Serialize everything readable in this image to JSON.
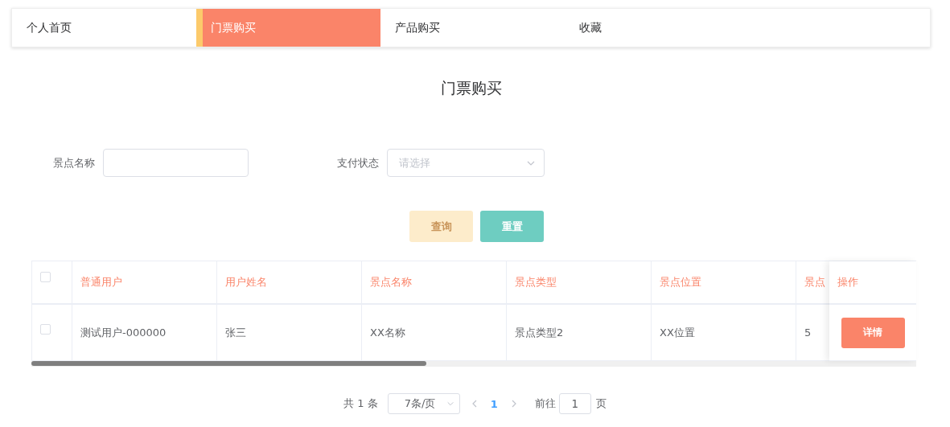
{
  "nav_tabs": [
    {
      "label": "个人首页",
      "selected": false
    },
    {
      "label": "门票购买",
      "selected": true
    },
    {
      "label": "产品购买",
      "selected": false
    },
    {
      "label": "收藏",
      "selected": false
    }
  ],
  "page_title": "门票购买",
  "filters": {
    "name_label": "景点名称",
    "status_label": "支付状态",
    "status_placeholder": "请选择"
  },
  "buttons": [
    {
      "label": "查询",
      "kind": "primary",
      "disabled": true
    },
    {
      "label": "重置",
      "kind": "reset",
      "disabled": false
    }
  ],
  "table": {
    "select_all_checked": false,
    "columns": [
      "普通用户",
      "用户姓名",
      "景点名称",
      "景点类型",
      "景点位置",
      "景点"
    ],
    "action_column": "操作",
    "rows": [
      {
        "checked": false,
        "cells": [
          "测试用户-000000",
          "张三",
          "XX名称",
          "景点类型2",
          "XX位置",
          "5"
        ],
        "action": "详情"
      }
    ]
  },
  "pagination": {
    "total": "共 1 条",
    "page_size": "7条/页",
    "pages": [
      {
        "label": "1",
        "selected": true
      }
    ],
    "goto_label": "前往",
    "goto_value": "1",
    "goto_suffix": "页"
  }
}
